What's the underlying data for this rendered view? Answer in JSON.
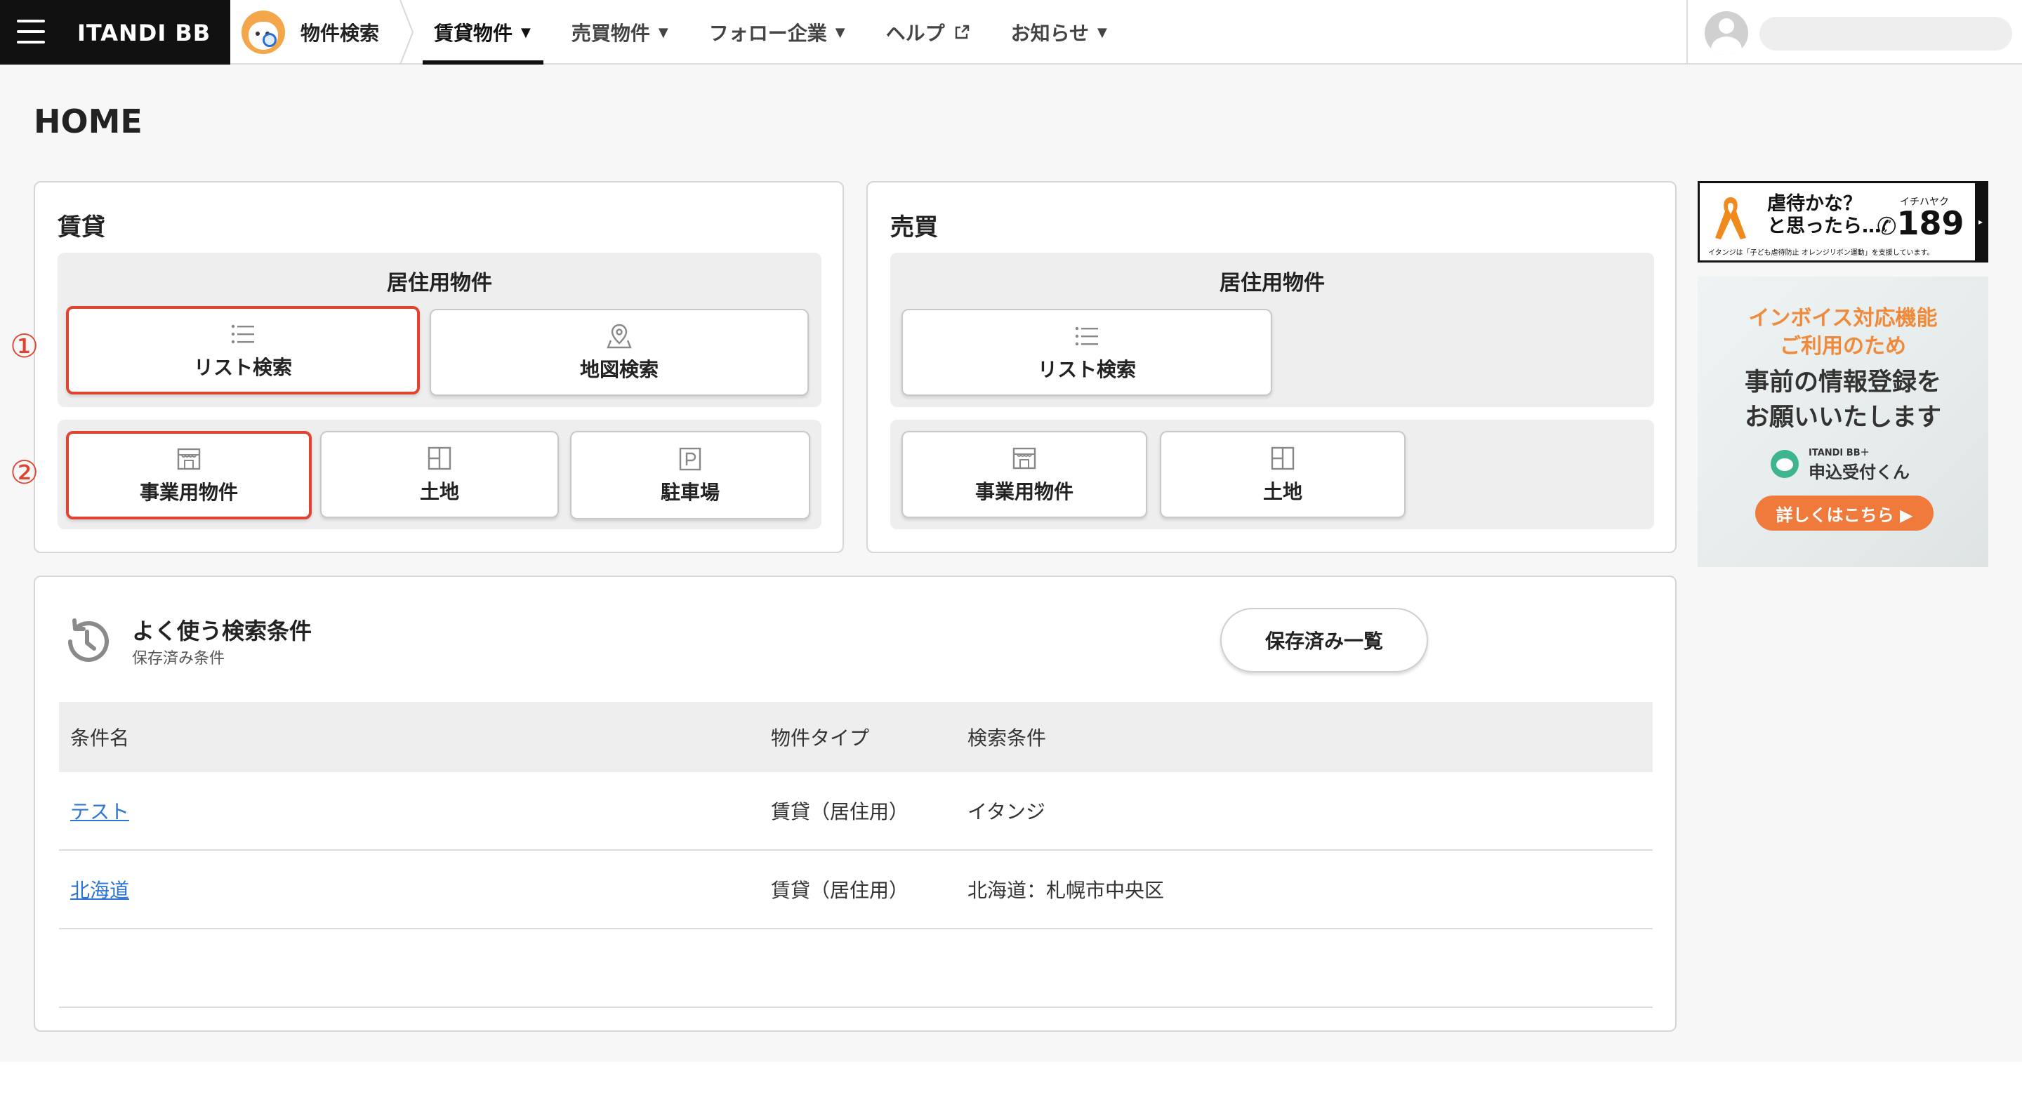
{
  "header": {
    "brand": "ITANDI BB",
    "app_label": "物件検索",
    "nav": [
      {
        "label": "賃貸物件",
        "active": true,
        "has_caret": true
      },
      {
        "label": "売買物件",
        "has_caret": true
      },
      {
        "label": "フォロー企業",
        "has_caret": true
      },
      {
        "label": "ヘルプ",
        "external": true
      },
      {
        "label": "お知らせ",
        "has_caret": true
      }
    ],
    "caret": "⌄",
    "external_icon": "⧉"
  },
  "page_title": "HOME",
  "rent": {
    "title": "賃貸",
    "residential_title": "居住用物件",
    "list_search": "リスト検索",
    "map_search": "地図検索",
    "business": "事業用物件",
    "land": "土地",
    "parking": "駐車場",
    "marker1": "①",
    "marker2": "②"
  },
  "sale": {
    "title": "売買",
    "residential_title": "居住用物件",
    "list_search": "リスト検索",
    "business": "事業用物件",
    "land": "土地"
  },
  "saved": {
    "title": "よく使う検索条件",
    "subtitle": "保存済み条件",
    "list_button": "保存済み一覧",
    "columns": [
      "条件名",
      "物件タイプ",
      "検索条件"
    ],
    "rows": [
      {
        "name": "テスト",
        "type": "賃貸（居住用）",
        "condition": "イタンジ"
      },
      {
        "name": "北海道",
        "type": "賃貸（居住用）",
        "condition": "北海道：札幌市中央区"
      }
    ]
  },
  "banner1": {
    "line1": "虐待かな？",
    "line2": "と思ったら…",
    "kana": "イチハヤク",
    "number": "189",
    "footnote": "イタンジは「子ども虐待防止 オレンジリボン運動」を支援しています。"
  },
  "banner2": {
    "line1": "インボイス対応機能",
    "line2": "ご利用のため",
    "main1": "事前の情報登録を",
    "main2": "お願いいたします",
    "brand_small": "ITANDI BB＋",
    "brand_big": "申込受付くん",
    "cta": "詳しくはこちら ▶"
  },
  "colors": {
    "highlight": "#e0432f",
    "link": "#2b74d8",
    "accent_orange": "#f08a3a"
  }
}
